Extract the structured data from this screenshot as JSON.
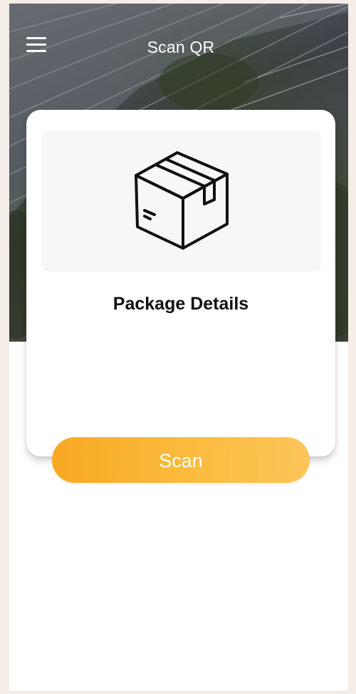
{
  "header": {
    "title": "Scan QR",
    "menu_icon": "hamburger-menu-icon"
  },
  "card": {
    "image_icon": "package-box-icon",
    "title": "Package Details"
  },
  "actions": {
    "scan_label": "Scan"
  },
  "colors": {
    "accent_start": "#f8a923",
    "accent_end": "#fdc55a",
    "page_background": "#f4ede8",
    "card_title": "#111111"
  }
}
